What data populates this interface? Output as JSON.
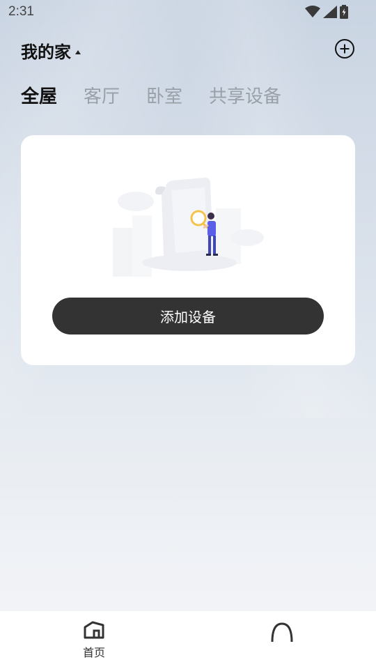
{
  "status_bar": {
    "time": "2:31"
  },
  "header": {
    "home_name": "我的家",
    "add_icon": "plus-circle-icon"
  },
  "tabs": [
    {
      "label": "全屋",
      "active": true
    },
    {
      "label": "客厅",
      "active": false
    },
    {
      "label": "卧室",
      "active": false
    },
    {
      "label": "共享设备",
      "active": false
    }
  ],
  "empty_card": {
    "illustration": "empty-devices-illustration",
    "button_label": "添加设备"
  },
  "bottom_nav": {
    "items": [
      {
        "label": "首页",
        "icon": "home-icon",
        "active": true
      },
      {
        "label": "",
        "icon": "profile-icon",
        "active": false
      }
    ]
  },
  "colors": {
    "accent_dark": "#333333",
    "card_bg": "#ffffff",
    "tab_inactive": "#9aa0a8",
    "figure_shirt": "#5b5ee8"
  }
}
